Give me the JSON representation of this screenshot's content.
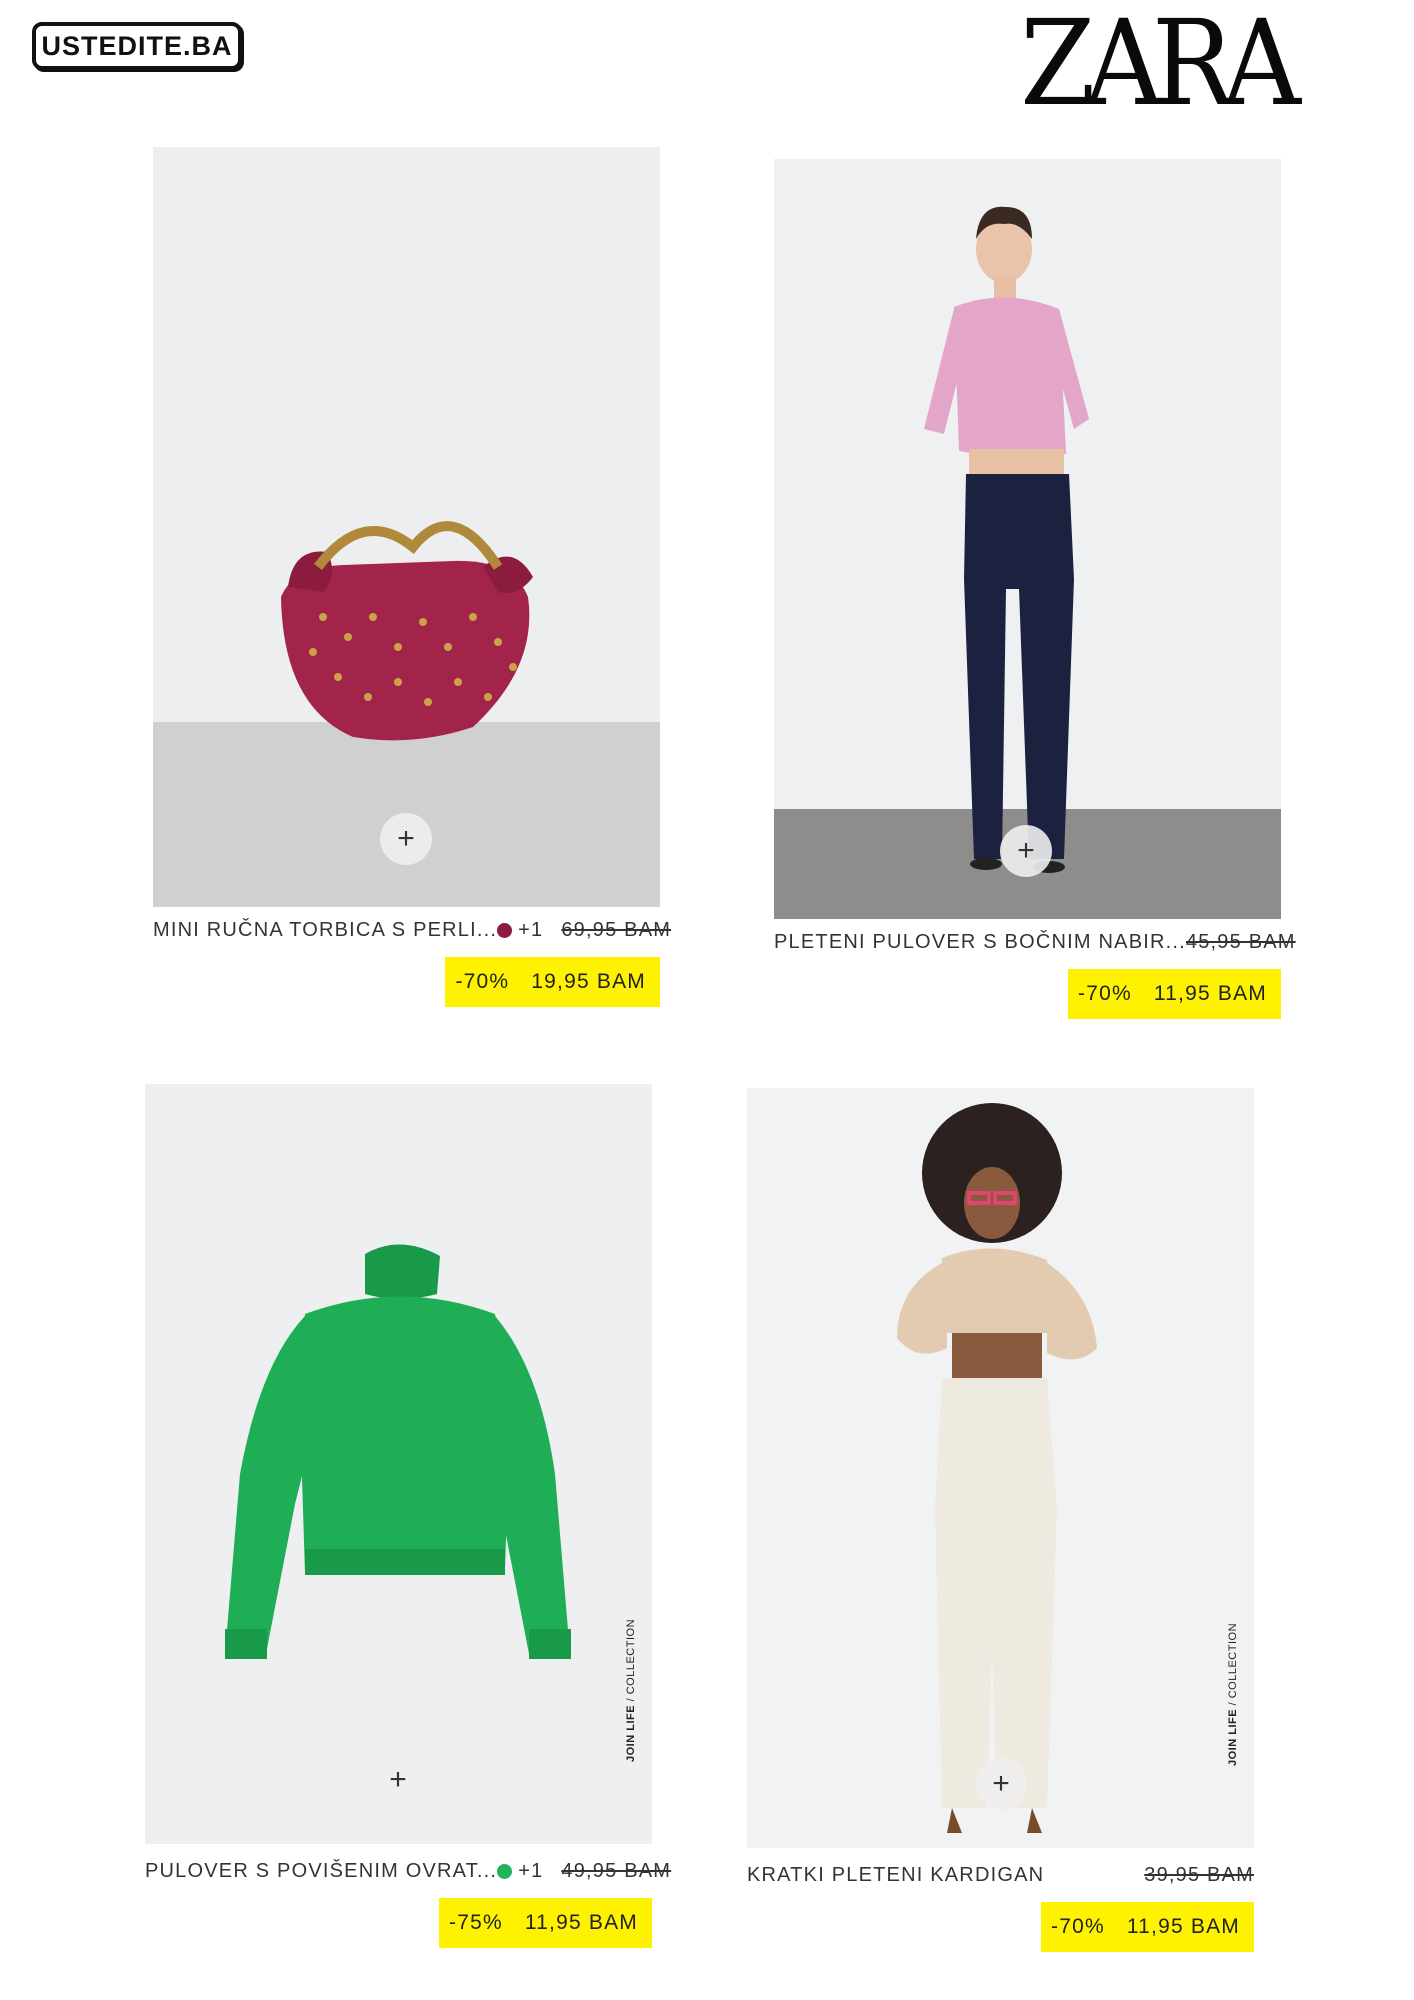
{
  "header": {
    "left_logo": "USTEDITE.BA",
    "right_logo": "ZARA"
  },
  "products": [
    {
      "name": "MINI RUČNA TORBICA S PERLI...",
      "swatch_color": "#8b1d3f",
      "swatch_more": "+1",
      "old_price": "69,95 BAM",
      "discount": "-70%",
      "new_price": "19,95 BAM",
      "add_icon": "+"
    },
    {
      "name": "PLETENI PULOVER S BOČNIM NABIR...",
      "old_price": "45,95 BAM",
      "discount": "-70%",
      "new_price": "11,95 BAM",
      "add_icon": "+"
    },
    {
      "name": "PULOVER S POVIŠENIM OVRAT...",
      "swatch_color": "#22b35c",
      "swatch_more": "+1",
      "old_price": "49,95 BAM",
      "discount": "-75%",
      "new_price": "11,95 BAM",
      "add_icon": "+",
      "badge_bold": "JOIN LIFE",
      "badge_rest": " / COLLECTION"
    },
    {
      "name": "KRATKI PLETENI KARDIGAN",
      "old_price": "39,95 BAM",
      "discount": "-70%",
      "new_price": "11,95 BAM",
      "add_icon": "+",
      "badge_bold": "JOIN LIFE",
      "badge_rest": " / COLLECTION"
    }
  ],
  "colors": {
    "price_highlight": "#fff200",
    "bag": "#a3244a",
    "sweater_pink": "#e3a6c8",
    "jeans": "#1c2140",
    "sweater_green": "#1fae55",
    "cardigan": "#e2cbb0",
    "skirt": "#efeadf"
  }
}
